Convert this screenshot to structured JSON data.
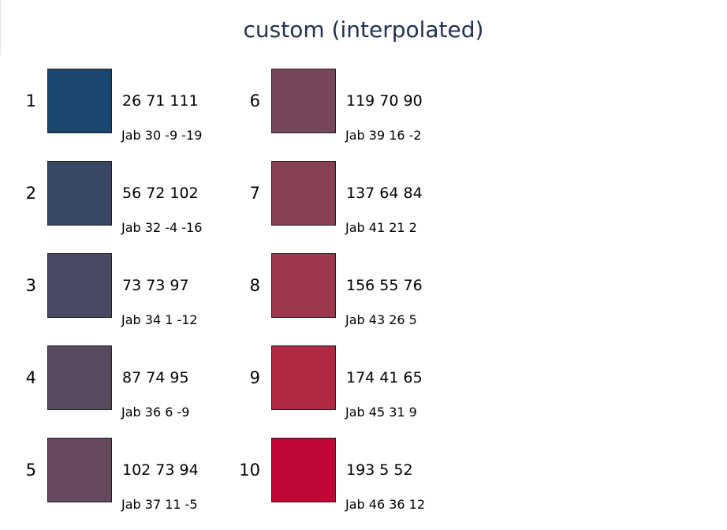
{
  "title": "custom (interpolated)",
  "swatches": [
    {
      "index": "1",
      "rgb": "26 71 111",
      "jab": "Jab 30 -9 -19",
      "color": "#1a476f"
    },
    {
      "index": "2",
      "rgb": "56 72 102",
      "jab": "Jab 32 -4 -16",
      "color": "#384866"
    },
    {
      "index": "3",
      "rgb": "73 73 97",
      "jab": "Jab 34 1 -12",
      "color": "#494961"
    },
    {
      "index": "4",
      "rgb": "87 74 95",
      "jab": "Jab 36 6 -9",
      "color": "#574a5f"
    },
    {
      "index": "5",
      "rgb": "102 73 94",
      "jab": "Jab 37 11 -5",
      "color": "#66495e"
    },
    {
      "index": "6",
      "rgb": "119 70 90",
      "jab": "Jab 39 16 -2",
      "color": "#77465a"
    },
    {
      "index": "7",
      "rgb": "137 64 84",
      "jab": "Jab 41 21 2",
      "color": "#894054"
    },
    {
      "index": "8",
      "rgb": "156 55 76",
      "jab": "Jab 43 26 5",
      "color": "#9c374c"
    },
    {
      "index": "9",
      "rgb": "174 41 65",
      "jab": "Jab 45 31 9",
      "color": "#ae2941"
    },
    {
      "index": "10",
      "rgb": "193 5 52",
      "jab": "Jab 46 36 12",
      "color": "#c10534"
    }
  ]
}
